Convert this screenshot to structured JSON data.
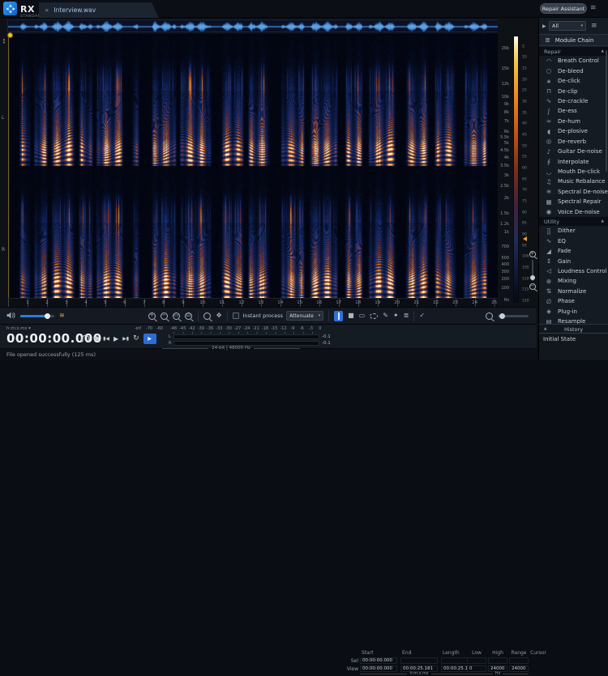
{
  "titlebar": {
    "product": "RX",
    "edition": "STANDARD",
    "tab_title": "Interview.wav",
    "close_glyph": "✕",
    "repair_assistant": "Repair Assistant"
  },
  "icons": {
    "play": "▶",
    "chevron_down": "▾",
    "menu": "≡",
    "collapse": "▲",
    "tri_up": "▴",
    "tri_down": "▾",
    "plus": "+",
    "minus": "−",
    "rect": "▭",
    "full": "⊡",
    "hand": "✥",
    "square": "■",
    "brush": "✎",
    "wand": "✦",
    "lines": "≣",
    "check": "✓",
    "record": "●",
    "prev": "▮◀",
    "next": "▶▮",
    "loop": "↻",
    "waves": "≋",
    "sliders": "≋",
    "chain": "≣"
  },
  "colors": {
    "accent_blue": "#2e72da",
    "playhead_yellow": "#f0c424",
    "legend_handle_orange": "#e0a23c"
  },
  "panel": {
    "filter": "All",
    "module_chain": "Module Chain",
    "sections": [
      {
        "title": "Repair",
        "items": [
          {
            "slug": "breath-control",
            "label": "Breath Control",
            "glyph": "◠"
          },
          {
            "slug": "de-bleed",
            "label": "De-bleed",
            "glyph": "○"
          },
          {
            "slug": "de-click",
            "label": "De-click",
            "glyph": "∗"
          },
          {
            "slug": "de-clip",
            "label": "De-clip",
            "glyph": "⊓"
          },
          {
            "slug": "de-crackle",
            "label": "De-crackle",
            "glyph": "∿"
          },
          {
            "slug": "de-ess",
            "label": "De-ess",
            "glyph": "∫"
          },
          {
            "slug": "de-hum",
            "label": "De-hum",
            "glyph": "≈"
          },
          {
            "slug": "de-plosive",
            "label": "De-plosive",
            "glyph": "◖"
          },
          {
            "slug": "de-reverb",
            "label": "De-reverb",
            "glyph": "◎"
          },
          {
            "slug": "guitar-de-noise",
            "label": "Guitar De-noise",
            "glyph": "♪"
          },
          {
            "slug": "interpolate",
            "label": "Interpolate",
            "glyph": "∮"
          },
          {
            "slug": "mouth-de-click",
            "label": "Mouth De-click",
            "glyph": "◡"
          },
          {
            "slug": "music-rebalance",
            "label": "Music Rebalance",
            "glyph": "♫"
          },
          {
            "slug": "spectral-de-noise",
            "label": "Spectral De-noise",
            "glyph": "≋"
          },
          {
            "slug": "spectral-repair",
            "label": "Spectral Repair",
            "glyph": "▦"
          },
          {
            "slug": "voice-de-noise",
            "label": "Voice De-noise",
            "glyph": "◉"
          }
        ]
      },
      {
        "title": "Utility",
        "items": [
          {
            "slug": "dither",
            "label": "Dither",
            "glyph": "⣿"
          },
          {
            "slug": "eq",
            "label": "EQ",
            "glyph": "∿"
          },
          {
            "slug": "fade",
            "label": "Fade",
            "glyph": "◢"
          },
          {
            "slug": "gain",
            "label": "Gain",
            "glyph": "↕"
          },
          {
            "slug": "loudness-control",
            "label": "Loudness Control",
            "glyph": "◁"
          },
          {
            "slug": "mixing",
            "label": "Mixing",
            "glyph": "⊕"
          },
          {
            "slug": "normalize",
            "label": "Normalize",
            "glyph": "⇅"
          },
          {
            "slug": "phase",
            "label": "Phase",
            "glyph": "∅"
          },
          {
            "slug": "plug-in",
            "label": "Plug-in",
            "glyph": "◈"
          },
          {
            "slug": "resample",
            "label": "Resample",
            "glyph": "▤"
          }
        ]
      }
    ],
    "history": {
      "title": "History",
      "items": [
        "Initial State"
      ]
    }
  },
  "spectrogram": {
    "channels": [
      "L",
      "R"
    ],
    "freq_unit": "Hz",
    "freq_ticks": [
      {
        "f": 20000,
        "label": "20k"
      },
      {
        "f": 15000,
        "label": "15k"
      },
      {
        "f": 12000,
        "label": "12k"
      },
      {
        "f": 10000,
        "label": "10k"
      },
      {
        "f": 9000,
        "label": "9k"
      },
      {
        "f": 8000,
        "label": "8k"
      },
      {
        "f": 7000,
        "label": "7k"
      },
      {
        "f": 6000,
        "label": "6k"
      },
      {
        "f": 5500,
        "label": "5.5k"
      },
      {
        "f": 5000,
        "label": "5k"
      },
      {
        "f": 4500,
        "label": "4.5k"
      },
      {
        "f": 4000,
        "label": "4k"
      },
      {
        "f": 3500,
        "label": "3.5k"
      },
      {
        "f": 3000,
        "label": "3k"
      },
      {
        "f": 2500,
        "label": "2.5k"
      },
      {
        "f": 2000,
        "label": "2k"
      },
      {
        "f": 1500,
        "label": "1.5k"
      },
      {
        "f": 1200,
        "label": "1.2k"
      },
      {
        "f": 1000,
        "label": "1k"
      },
      {
        "f": 700,
        "label": "700"
      },
      {
        "f": 500,
        "label": "500"
      },
      {
        "f": 400,
        "label": "400"
      },
      {
        "f": 300,
        "label": "300"
      },
      {
        "f": 200,
        "label": "200"
      },
      {
        "f": 100,
        "label": "100"
      }
    ],
    "db_ticks": [
      5,
      10,
      15,
      20,
      25,
      30,
      35,
      40,
      45,
      50,
      55,
      60,
      65,
      70,
      75,
      80,
      85,
      90,
      95,
      100,
      105,
      110,
      115,
      120
    ],
    "timeline_labels": [
      "1",
      "2",
      "3",
      "4",
      "5",
      "6",
      "7",
      "8",
      "9",
      "10",
      "11",
      "12",
      "13",
      "14",
      "15",
      "16",
      "17",
      "18",
      "19",
      "20",
      "21",
      "22",
      "23",
      "24",
      "25"
    ],
    "duration_s": 25.181
  },
  "toolbar": {
    "instant_process": "Instant process",
    "mode": "Attenuate"
  },
  "transport": {
    "format": "h:m:s.ms",
    "time": "00:00:00.000"
  },
  "meter": {
    "scale": [
      "-inf",
      "-70",
      "-60",
      "-48",
      "-45",
      "-42",
      "-39",
      "-36",
      "-33",
      "-30",
      "-27",
      "-24",
      "-21",
      "-18",
      "-15",
      "-12",
      "-9",
      "-6",
      "-3",
      "0"
    ],
    "channel_l": "L",
    "channel_r": "R",
    "peak_l": "-0.1",
    "peak_r": "-0.1",
    "format_line": "24-bit | 48000 Hz"
  },
  "selection": {
    "columns": [
      "Start",
      "End",
      "Length",
      "Low",
      "High",
      "Range",
      "Cursor"
    ],
    "row_labels": [
      "Sel",
      "View"
    ],
    "sel": [
      "00:00:00.000",
      "",
      "",
      "",
      "",
      ""
    ],
    "view": [
      "00:00:00.000",
      "00:00:25.181",
      "00:00:25.181",
      "0",
      "24000",
      "24000"
    ],
    "time_unit": "h:m:s.ms",
    "freq_unit": "Hz"
  },
  "status": {
    "message": "File opened successfully (125 ms)"
  }
}
